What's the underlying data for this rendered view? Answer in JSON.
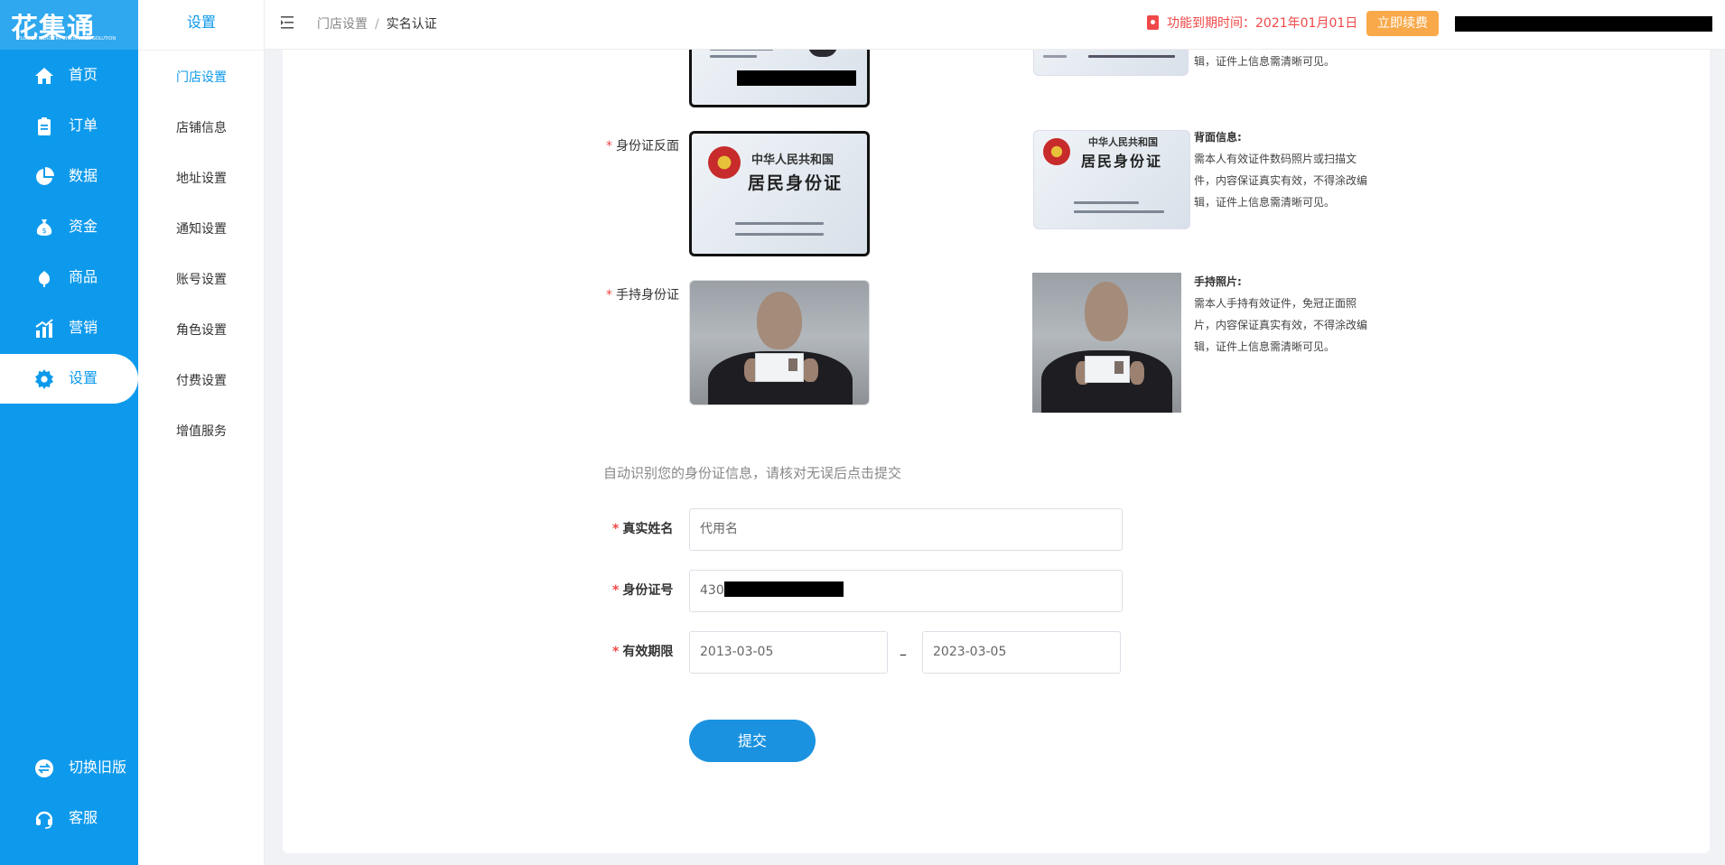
{
  "nav": {
    "logo_text": "花集通",
    "logo_sub": "FLOWER INDUSTRY INTEGRATED SOLUTION",
    "items": [
      {
        "label": "首页",
        "icon": "home-icon"
      },
      {
        "label": "订单",
        "icon": "clipboard-icon"
      },
      {
        "label": "数据",
        "icon": "pie-chart-icon"
      },
      {
        "label": "资金",
        "icon": "money-bag-icon"
      },
      {
        "label": "商品",
        "icon": "flower-icon"
      },
      {
        "label": "营销",
        "icon": "bar-chart-icon"
      },
      {
        "label": "设置",
        "icon": "gear-icon",
        "active": true
      }
    ],
    "bottom": [
      {
        "label": "切换旧版",
        "icon": "switch-icon"
      },
      {
        "label": "客服",
        "icon": "headset-icon"
      }
    ]
  },
  "submenu": {
    "title": "设置",
    "items": [
      "门店设置",
      "店铺信息",
      "地址设置",
      "通知设置",
      "账号设置",
      "角色设置",
      "付费设置",
      "增值服务"
    ],
    "active": "门店设置"
  },
  "header": {
    "breadcrumb": [
      "门店设置",
      "实名认证"
    ],
    "breadcrumb_sep": "/",
    "expire_text": "功能到期时间：2021年01月01日",
    "renew_button": "立即续费"
  },
  "id_upload": {
    "front_example_desc_tail": "辑，证件上信息需清晰可见。",
    "back": {
      "label": "身份证反面",
      "card_line1": "中华人民共和国",
      "card_line2": "居民身份证",
      "desc_title": "背面信息:",
      "desc_body": "需本人有效证件数码照片或扫描文件，内容保证真实有效，不得涂改编辑，证件上信息需清晰可见。"
    },
    "handheld": {
      "label": "手持身份证",
      "desc_title": "手持照片:",
      "desc_body": "需本人手持有效证件，免冠正面照片，内容保证真实有效，不得涂改编辑，证件上信息需清晰可见。"
    }
  },
  "form": {
    "note": "自动识别您的身份证信息，请核对无误后点击提交",
    "name_label": "真实姓名",
    "name_value": "代用名",
    "id_label": "身份证号",
    "id_value": "430",
    "validity_label": "有效期限",
    "validity_start": "2013-03-05",
    "validity_end": "2023-03-05",
    "range_sep": "–",
    "submit": "提交"
  },
  "colors": {
    "primary": "#0e9aec",
    "warning": "#f04848",
    "renew": "#f9a94a"
  }
}
